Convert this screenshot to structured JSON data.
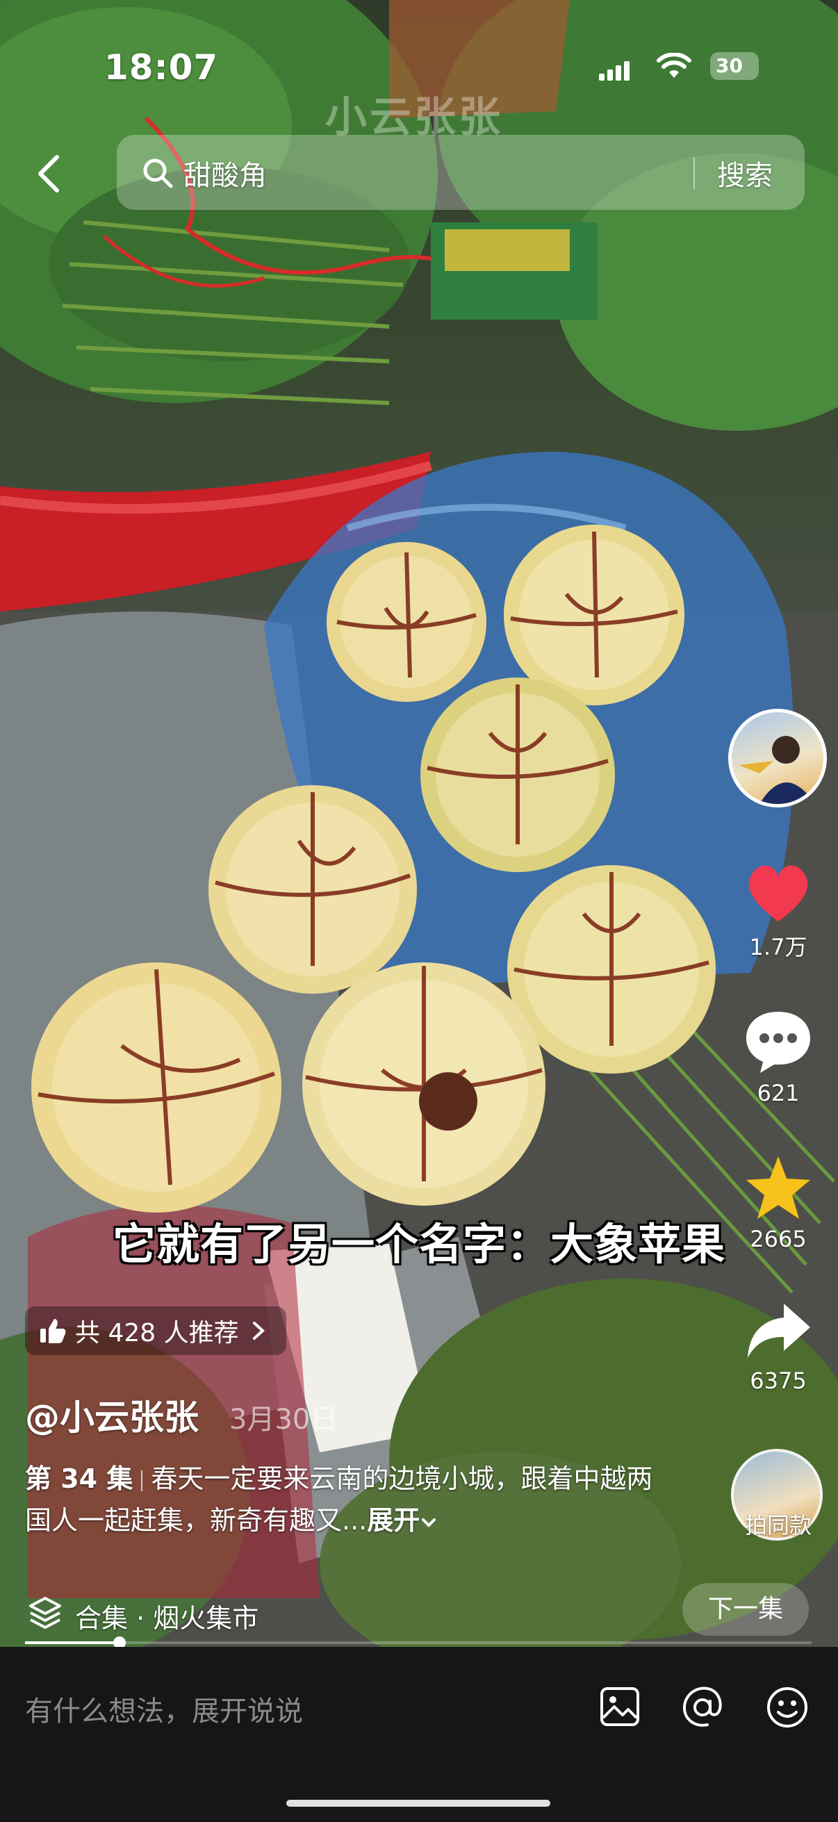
{
  "status_bar": {
    "time": "18:07",
    "battery": "30"
  },
  "search": {
    "query": "甜酸角",
    "button": "搜索"
  },
  "watermark": "小云张张",
  "subtitle": "它就有了另一个名字：大象苹果",
  "recommend": {
    "label": "共 428 人推荐"
  },
  "author": {
    "name": "@小云张张",
    "date": "3月30日"
  },
  "description": {
    "episode": "第 34 集",
    "text": "春天一定要来云南的边境小城，跟着中越两国人一起赶集，新奇有趣又...",
    "more": "展开"
  },
  "collection": {
    "label": "合集 · 烟火集市",
    "next": "下一集"
  },
  "rail": {
    "likes": "1.7万",
    "comments": "621",
    "favorites": "2665",
    "shares": "6375",
    "same_style": "拍同款"
  },
  "progress": {
    "fraction": 0.12
  },
  "comment_bar": {
    "placeholder": "有什么想法，展开说说"
  },
  "colors": {
    "like": "#f2394f",
    "star": "#f7c21b",
    "background": "#161616"
  }
}
